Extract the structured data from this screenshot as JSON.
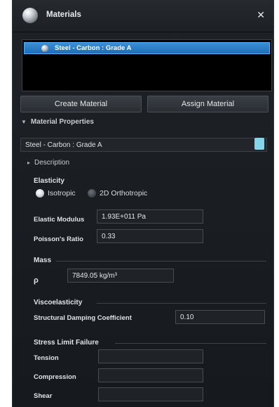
{
  "window": {
    "title": "Materials",
    "close_glyph": "✕"
  },
  "materials_list": {
    "selected": "Steel - Carbon : Grade A"
  },
  "buttons": {
    "create": "Create Material",
    "assign": "Assign Material"
  },
  "material_properties": {
    "header": "Material Properties",
    "selected_material": "Steel - Carbon : Grade A",
    "description_header": "Description",
    "swatch_color": "#86d4ea"
  },
  "elasticity": {
    "header": "Elasticity",
    "options": [
      "Isotropic",
      "2D Orthotropic"
    ],
    "selected": "Isotropic",
    "elastic_modulus_label": "Elastic Modulus",
    "elastic_modulus_value": "1.93E+011 Pa",
    "poissons_ratio_label": "Poisson's Ratio",
    "poissons_ratio_value": "0.33"
  },
  "mass": {
    "header": "Mass",
    "density_label": "ρ",
    "density_value": "7849.05 kg/m³"
  },
  "viscoelasticity": {
    "header": "Viscoelasticity",
    "damping_label": "Structural Damping Coefficient",
    "damping_value": "0.10"
  },
  "stress_limit": {
    "header": "Stress Limit Failure",
    "tension_label": "Tension",
    "tension_value": "",
    "compression_label": "Compression",
    "compression_value": "",
    "shear_label": "Shear",
    "shear_value": ""
  },
  "icons": {
    "title_icon": "material-sphere-icon",
    "item_icon": "material-sphere-icon",
    "collapse_caret": "caret-down-icon",
    "expand_caret": "caret-right-icon"
  },
  "colors": {
    "selection": "#2a7fcc",
    "panel_bg": "#1b1e22",
    "swatch": "#86d4ea"
  }
}
